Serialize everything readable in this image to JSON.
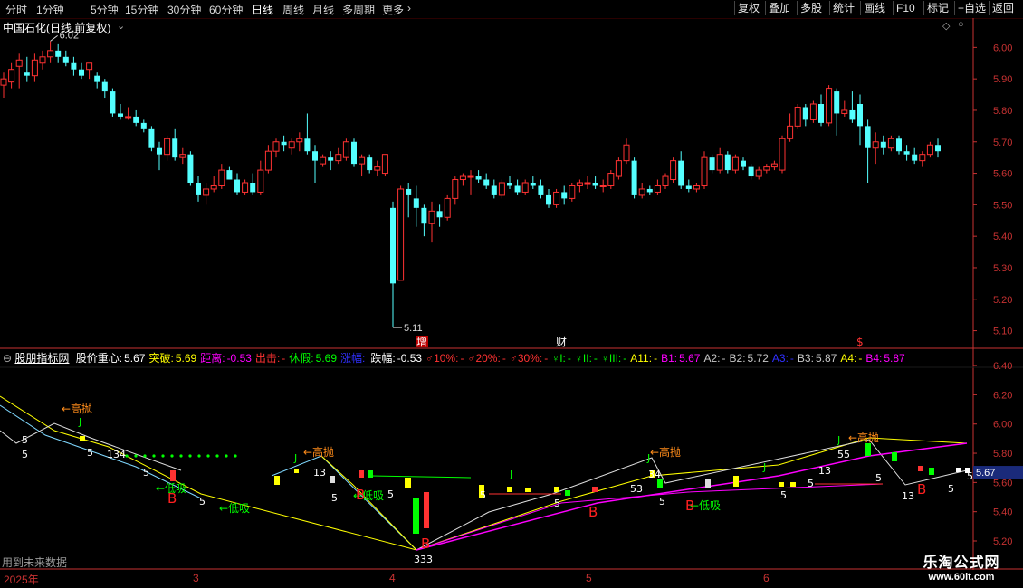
{
  "toolbar": {
    "periods": [
      "分时",
      "1分钟",
      "5分钟",
      "15分钟",
      "30分钟",
      "60分钟",
      "日线",
      "周线",
      "月线",
      "多周期",
      "更多"
    ],
    "active_period": "日线",
    "more_chevron": "›",
    "buttons": [
      "复权",
      "叠加",
      "多股",
      "统计",
      "画线",
      "F10",
      "标记",
      "+自选",
      "返回"
    ]
  },
  "main": {
    "title": "中国石化(日线,前复权)",
    "price_ticks": [
      "6.00",
      "5.90",
      "5.80",
      "5.70",
      "5.60",
      "5.50",
      "5.40",
      "5.30",
      "5.20",
      "5.10"
    ],
    "high_label": "6.02",
    "low_label": "5.11",
    "event_markers": [
      "增",
      "财",
      "$"
    ],
    "colors": {
      "up": "#ff3232",
      "down": "#54ffff",
      "axis": "#c83232"
    },
    "chart_data": {
      "type": "candlestick",
      "ylim": [
        5.07,
        6.07
      ],
      "candles": [
        {
          "o": 5.88,
          "h": 5.92,
          "l": 5.84,
          "c": 5.9
        },
        {
          "o": 5.89,
          "h": 5.95,
          "l": 5.87,
          "c": 5.93
        },
        {
          "o": 5.94,
          "h": 5.98,
          "l": 5.87,
          "c": 5.96
        },
        {
          "o": 5.92,
          "h": 5.97,
          "l": 5.89,
          "c": 5.91
        },
        {
          "o": 5.91,
          "h": 5.98,
          "l": 5.89,
          "c": 5.96
        },
        {
          "o": 5.95,
          "h": 5.99,
          "l": 5.93,
          "c": 5.97
        },
        {
          "o": 5.97,
          "h": 6.02,
          "l": 5.95,
          "c": 5.99
        },
        {
          "o": 5.99,
          "h": 6.01,
          "l": 5.95,
          "c": 5.97
        },
        {
          "o": 5.97,
          "h": 5.99,
          "l": 5.94,
          "c": 5.95
        },
        {
          "o": 5.95,
          "h": 5.97,
          "l": 5.91,
          "c": 5.93
        },
        {
          "o": 5.93,
          "h": 5.95,
          "l": 5.9,
          "c": 5.91
        },
        {
          "o": 5.93,
          "h": 5.95,
          "l": 5.9,
          "c": 5.95
        },
        {
          "o": 5.91,
          "h": 5.92,
          "l": 5.87,
          "c": 5.89
        },
        {
          "o": 5.89,
          "h": 5.9,
          "l": 5.84,
          "c": 5.86
        },
        {
          "o": 5.86,
          "h": 5.87,
          "l": 5.78,
          "c": 5.79
        },
        {
          "o": 5.79,
          "h": 5.82,
          "l": 5.77,
          "c": 5.78
        },
        {
          "o": 5.78,
          "h": 5.81,
          "l": 5.77,
          "c": 5.78
        },
        {
          "o": 5.78,
          "h": 5.8,
          "l": 5.75,
          "c": 5.76
        },
        {
          "o": 5.76,
          "h": 5.77,
          "l": 5.73,
          "c": 5.74
        },
        {
          "o": 5.74,
          "h": 5.75,
          "l": 5.67,
          "c": 5.68
        },
        {
          "o": 5.68,
          "h": 5.7,
          "l": 5.61,
          "c": 5.66
        },
        {
          "o": 5.66,
          "h": 5.72,
          "l": 5.64,
          "c": 5.71
        },
        {
          "o": 5.71,
          "h": 5.74,
          "l": 5.64,
          "c": 5.65
        },
        {
          "o": 5.65,
          "h": 5.68,
          "l": 5.63,
          "c": 5.66
        },
        {
          "o": 5.66,
          "h": 5.67,
          "l": 5.56,
          "c": 5.57
        },
        {
          "o": 5.57,
          "h": 5.59,
          "l": 5.51,
          "c": 5.53
        },
        {
          "o": 5.53,
          "h": 5.57,
          "l": 5.5,
          "c": 5.55
        },
        {
          "o": 5.55,
          "h": 5.59,
          "l": 5.54,
          "c": 5.56
        },
        {
          "o": 5.56,
          "h": 5.63,
          "l": 5.55,
          "c": 5.61
        },
        {
          "o": 5.61,
          "h": 5.62,
          "l": 5.58,
          "c": 5.58
        },
        {
          "o": 5.58,
          "h": 5.6,
          "l": 5.53,
          "c": 5.54
        },
        {
          "o": 5.54,
          "h": 5.58,
          "l": 5.53,
          "c": 5.57
        },
        {
          "o": 5.57,
          "h": 5.6,
          "l": 5.53,
          "c": 5.54
        },
        {
          "o": 5.54,
          "h": 5.64,
          "l": 5.53,
          "c": 5.61
        },
        {
          "o": 5.61,
          "h": 5.69,
          "l": 5.6,
          "c": 5.67
        },
        {
          "o": 5.67,
          "h": 5.71,
          "l": 5.65,
          "c": 5.7
        },
        {
          "o": 5.7,
          "h": 5.72,
          "l": 5.67,
          "c": 5.69
        },
        {
          "o": 5.68,
          "h": 5.71,
          "l": 5.66,
          "c": 5.7
        },
        {
          "o": 5.7,
          "h": 5.73,
          "l": 5.67,
          "c": 5.71
        },
        {
          "o": 5.71,
          "h": 5.79,
          "l": 5.66,
          "c": 5.67
        },
        {
          "o": 5.67,
          "h": 5.69,
          "l": 5.57,
          "c": 5.64
        },
        {
          "o": 5.63,
          "h": 5.66,
          "l": 5.62,
          "c": 5.65
        },
        {
          "o": 5.65,
          "h": 5.67,
          "l": 5.61,
          "c": 5.64
        },
        {
          "o": 5.64,
          "h": 5.68,
          "l": 5.63,
          "c": 5.66
        },
        {
          "o": 5.65,
          "h": 5.71,
          "l": 5.64,
          "c": 5.7
        },
        {
          "o": 5.7,
          "h": 5.71,
          "l": 5.62,
          "c": 5.63
        },
        {
          "o": 5.63,
          "h": 5.66,
          "l": 5.59,
          "c": 5.65
        },
        {
          "o": 5.65,
          "h": 5.66,
          "l": 5.6,
          "c": 5.61
        },
        {
          "o": 5.61,
          "h": 5.64,
          "l": 5.59,
          "c": 5.62
        },
        {
          "o": 5.6,
          "h": 5.66,
          "l": 5.59,
          "c": 5.66
        },
        {
          "o": 5.49,
          "h": 5.51,
          "l": 5.11,
          "c": 5.25
        },
        {
          "o": 5.26,
          "h": 5.56,
          "l": 5.26,
          "c": 5.55
        },
        {
          "o": 5.55,
          "h": 5.57,
          "l": 5.46,
          "c": 5.53
        },
        {
          "o": 5.52,
          "h": 5.56,
          "l": 5.43,
          "c": 5.49
        },
        {
          "o": 5.49,
          "h": 5.5,
          "l": 5.4,
          "c": 5.44
        },
        {
          "o": 5.44,
          "h": 5.51,
          "l": 5.38,
          "c": 5.48
        },
        {
          "o": 5.48,
          "h": 5.5,
          "l": 5.43,
          "c": 5.46
        },
        {
          "o": 5.46,
          "h": 5.53,
          "l": 5.45,
          "c": 5.52
        },
        {
          "o": 5.52,
          "h": 5.59,
          "l": 5.5,
          "c": 5.58
        },
        {
          "o": 5.58,
          "h": 5.6,
          "l": 5.56,
          "c": 5.59
        },
        {
          "o": 5.59,
          "h": 5.61,
          "l": 5.53,
          "c": 5.59
        },
        {
          "o": 5.59,
          "h": 5.61,
          "l": 5.57,
          "c": 5.58
        },
        {
          "o": 5.58,
          "h": 5.6,
          "l": 5.55,
          "c": 5.56
        },
        {
          "o": 5.56,
          "h": 5.58,
          "l": 5.52,
          "c": 5.53
        },
        {
          "o": 5.53,
          "h": 5.58,
          "l": 5.52,
          "c": 5.57
        },
        {
          "o": 5.57,
          "h": 5.59,
          "l": 5.55,
          "c": 5.56
        },
        {
          "o": 5.56,
          "h": 5.58,
          "l": 5.53,
          "c": 5.54
        },
        {
          "o": 5.54,
          "h": 5.58,
          "l": 5.53,
          "c": 5.57
        },
        {
          "o": 5.57,
          "h": 5.59,
          "l": 5.55,
          "c": 5.56
        },
        {
          "o": 5.56,
          "h": 5.58,
          "l": 5.52,
          "c": 5.53
        },
        {
          "o": 5.53,
          "h": 5.55,
          "l": 5.49,
          "c": 5.5
        },
        {
          "o": 5.5,
          "h": 5.55,
          "l": 5.49,
          "c": 5.54
        },
        {
          "o": 5.54,
          "h": 5.56,
          "l": 5.5,
          "c": 5.52
        },
        {
          "o": 5.52,
          "h": 5.57,
          "l": 5.51,
          "c": 5.56
        },
        {
          "o": 5.56,
          "h": 5.58,
          "l": 5.54,
          "c": 5.57
        },
        {
          "o": 5.57,
          "h": 5.59,
          "l": 5.55,
          "c": 5.57
        },
        {
          "o": 5.57,
          "h": 5.59,
          "l": 5.55,
          "c": 5.56
        },
        {
          "o": 5.56,
          "h": 5.58,
          "l": 5.54,
          "c": 5.56
        },
        {
          "o": 5.56,
          "h": 5.61,
          "l": 5.55,
          "c": 5.6
        },
        {
          "o": 5.59,
          "h": 5.65,
          "l": 5.58,
          "c": 5.64
        },
        {
          "o": 5.64,
          "h": 5.71,
          "l": 5.63,
          "c": 5.69
        },
        {
          "o": 5.64,
          "h": 5.65,
          "l": 5.52,
          "c": 5.53
        },
        {
          "o": 5.53,
          "h": 5.57,
          "l": 5.52,
          "c": 5.55
        },
        {
          "o": 5.55,
          "h": 5.56,
          "l": 5.53,
          "c": 5.54
        },
        {
          "o": 5.54,
          "h": 5.58,
          "l": 5.53,
          "c": 5.56
        },
        {
          "o": 5.56,
          "h": 5.6,
          "l": 5.55,
          "c": 5.59
        },
        {
          "o": 5.58,
          "h": 5.65,
          "l": 5.57,
          "c": 5.64
        },
        {
          "o": 5.64,
          "h": 5.67,
          "l": 5.55,
          "c": 5.56
        },
        {
          "o": 5.56,
          "h": 5.58,
          "l": 5.54,
          "c": 5.55
        },
        {
          "o": 5.55,
          "h": 5.57,
          "l": 5.54,
          "c": 5.56
        },
        {
          "o": 5.56,
          "h": 5.67,
          "l": 5.55,
          "c": 5.65
        },
        {
          "o": 5.65,
          "h": 5.66,
          "l": 5.6,
          "c": 5.61
        },
        {
          "o": 5.61,
          "h": 5.68,
          "l": 5.6,
          "c": 5.66
        },
        {
          "o": 5.66,
          "h": 5.67,
          "l": 5.6,
          "c": 5.61
        },
        {
          "o": 5.61,
          "h": 5.66,
          "l": 5.6,
          "c": 5.65
        },
        {
          "o": 5.64,
          "h": 5.65,
          "l": 5.61,
          "c": 5.62
        },
        {
          "o": 5.62,
          "h": 5.63,
          "l": 5.58,
          "c": 5.59
        },
        {
          "o": 5.59,
          "h": 5.62,
          "l": 5.58,
          "c": 5.61
        },
        {
          "o": 5.61,
          "h": 5.63,
          "l": 5.6,
          "c": 5.62
        },
        {
          "o": 5.62,
          "h": 5.64,
          "l": 5.61,
          "c": 5.63
        },
        {
          "o": 5.61,
          "h": 5.72,
          "l": 5.6,
          "c": 5.71
        },
        {
          "o": 5.71,
          "h": 5.79,
          "l": 5.7,
          "c": 5.75
        },
        {
          "o": 5.75,
          "h": 5.82,
          "l": 5.74,
          "c": 5.81
        },
        {
          "o": 5.81,
          "h": 5.82,
          "l": 5.75,
          "c": 5.77
        },
        {
          "o": 5.77,
          "h": 5.83,
          "l": 5.76,
          "c": 5.82
        },
        {
          "o": 5.82,
          "h": 5.85,
          "l": 5.75,
          "c": 5.76
        },
        {
          "o": 5.76,
          "h": 5.88,
          "l": 5.75,
          "c": 5.87
        },
        {
          "o": 5.86,
          "h": 5.87,
          "l": 5.72,
          "c": 5.79
        },
        {
          "o": 5.79,
          "h": 5.83,
          "l": 5.78,
          "c": 5.8
        },
        {
          "o": 5.8,
          "h": 5.86,
          "l": 5.76,
          "c": 5.77
        },
        {
          "o": 5.82,
          "h": 5.85,
          "l": 5.69,
          "c": 5.75
        },
        {
          "o": 5.75,
          "h": 5.77,
          "l": 5.57,
          "c": 5.68
        },
        {
          "o": 5.68,
          "h": 5.73,
          "l": 5.63,
          "c": 5.7
        },
        {
          "o": 5.7,
          "h": 5.72,
          "l": 5.66,
          "c": 5.68
        },
        {
          "o": 5.68,
          "h": 5.72,
          "l": 5.67,
          "c": 5.71
        },
        {
          "o": 5.71,
          "h": 5.72,
          "l": 5.66,
          "c": 5.67
        },
        {
          "o": 5.67,
          "h": 5.69,
          "l": 5.64,
          "c": 5.66
        },
        {
          "o": 5.66,
          "h": 5.68,
          "l": 5.63,
          "c": 5.64
        },
        {
          "o": 5.64,
          "h": 5.67,
          "l": 5.62,
          "c": 5.66
        },
        {
          "o": 5.66,
          "h": 5.7,
          "l": 5.65,
          "c": 5.69
        },
        {
          "o": 5.69,
          "h": 5.71,
          "l": 5.65,
          "c": 5.67
        }
      ]
    }
  },
  "sub": {
    "indicator_name": "股朋指标网",
    "legend": [
      {
        "label": "股价重心",
        "value": "5.67",
        "color": "#ffffff"
      },
      {
        "label": "突破",
        "value": "5.69",
        "color": "#ffff00"
      },
      {
        "label": "距离",
        "value": "-0.53",
        "color": "#ff00ff"
      },
      {
        "label": "出击",
        "value": "-",
        "color": "#ff3232"
      },
      {
        "label": "休假",
        "value": "5.69",
        "color": "#00ff00"
      },
      {
        "label": "涨幅",
        "value": "",
        "color": "#3030ff"
      },
      {
        "label": "跌幅",
        "value": "-0.53",
        "color": "#ffffff"
      },
      {
        "label": "♂10%",
        "value": "-",
        "color": "#ff3232"
      },
      {
        "label": "♂20%",
        "value": "-",
        "color": "#ff3232"
      },
      {
        "label": "♂30%",
        "value": "-",
        "color": "#ff3232"
      },
      {
        "label": "♀I",
        "value": "-",
        "color": "#00ff00"
      },
      {
        "label": "♀II",
        "value": "-",
        "color": "#00ff00"
      },
      {
        "label": "♀III",
        "value": "-",
        "color": "#00ff00"
      },
      {
        "label": "A11",
        "value": "-",
        "color": "#ffff00"
      },
      {
        "label": "B1",
        "value": "5.67",
        "color": "#ff00ff"
      },
      {
        "label": "A2",
        "value": "-",
        "color": "#c8c8c8"
      },
      {
        "label": "B2",
        "value": "5.72",
        "color": "#c8c8c8"
      },
      {
        "label": "A3",
        "value": "-",
        "color": "#3030ff"
      },
      {
        "label": "B3",
        "value": "5.87",
        "color": "#c8c8c8"
      },
      {
        "label": "A4",
        "value": "-",
        "color": "#ffff00"
      },
      {
        "label": "B4",
        "value": "5.87",
        "color": "#ff00ff"
      }
    ],
    "price_ticks": [
      "6.40",
      "6.20",
      "6.00",
      "5.80",
      "5.60",
      "5.40",
      "5.20"
    ],
    "current_value": "5.67",
    "future_note": "用到未来数据",
    "signal_texts": {
      "high_sell": "←高抛",
      "low_buy": "←低吸",
      "buy": "B",
      "j": "J",
      "five": "5",
      "thirteen": "13",
      "one_three_four": "134",
      "thirty_four": "34",
      "five_five": "55",
      "three_three": "333",
      "five_three": "53"
    }
  },
  "dates": {
    "labels": [
      "2025年",
      "3",
      "4",
      "5",
      "6"
    ]
  },
  "watermark": {
    "title": "乐淘公式网",
    "url": "www.60lt.com"
  }
}
